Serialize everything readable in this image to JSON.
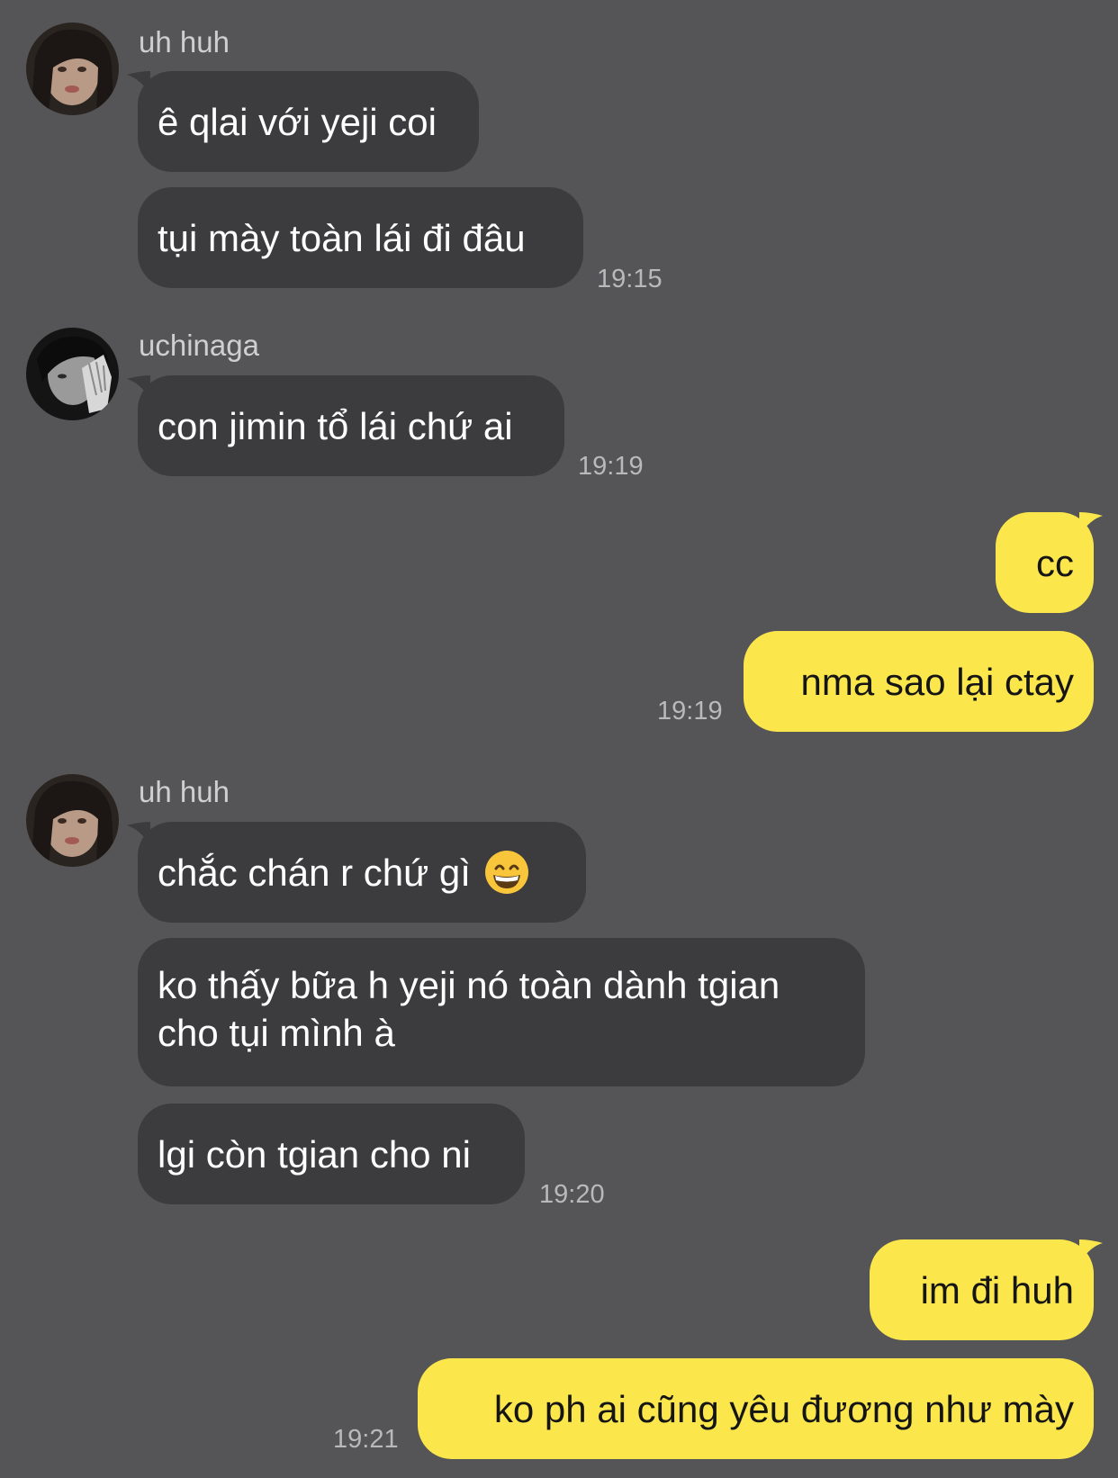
{
  "messages": {
    "g1": {
      "sender": "uh huh",
      "b1": "ê qlai với yeji coi",
      "b2": "tụi mày toàn lái đi đâu",
      "time": "19:15"
    },
    "g2": {
      "sender": "uchinaga",
      "b1": "con jimin tổ lái chứ ai",
      "time": "19:19"
    },
    "g3": {
      "b1": "cc",
      "b2": "nma sao lại ctay",
      "time": "19:19"
    },
    "g4": {
      "sender": "uh huh",
      "b1": "chắc chán r chứ gì",
      "b1_emoji": "grinning-face-with-smiling-eyes",
      "b2": "ko thấy bữa h yeji nó toàn dành tgian cho tụi mình à",
      "b3": "lgi còn tgian cho ni",
      "time": "19:20"
    },
    "g5": {
      "b1": "im đi huh",
      "b2": "ko ph ai cũng yêu đương như mày",
      "time": "19:21"
    }
  },
  "colors": {
    "background": "#555456",
    "incoming_bubble": "#3c3b3e",
    "outgoing_bubble": "#fbe74c",
    "sender_text": "#cfcfd1",
    "timestamp_text": "#b9b8bb"
  },
  "icons": [
    "avatar-uh-huh",
    "avatar-uchinaga",
    "grinning-emoji"
  ]
}
